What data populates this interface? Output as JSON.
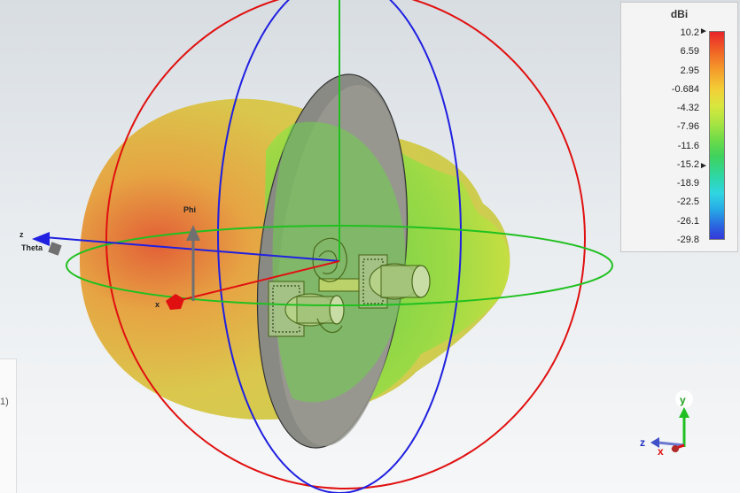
{
  "legend": {
    "title": "dBi",
    "values": [
      "10.2",
      "6.59",
      "2.95",
      "-0.684",
      "-4.32",
      "-7.96",
      "-11.6",
      "-15.2",
      "-18.9",
      "-22.5",
      "-26.1",
      "-29.8"
    ]
  },
  "axes": {
    "phi": "Phi",
    "theta": "Theta",
    "z": "z",
    "x": "x"
  },
  "triad": {
    "y": "y",
    "z": "z",
    "x": "x"
  },
  "side_panel": {
    "text": "1)"
  },
  "colors": {
    "x_axis": "#e01010",
    "y_axis": "#20c020",
    "z_axis": "#2020e0"
  }
}
